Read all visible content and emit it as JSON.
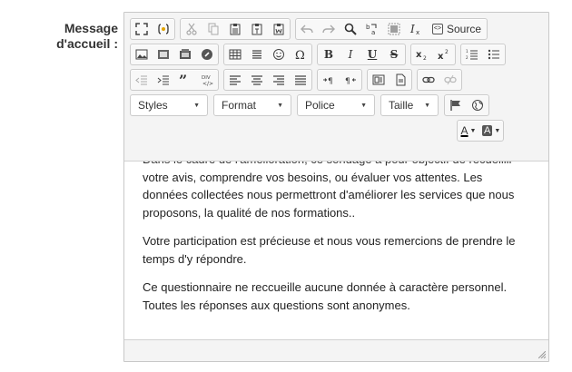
{
  "form": {
    "label": "Message d'accueil :"
  },
  "toolbar": {
    "source_label": "Source",
    "styles_label": "Styles",
    "format_label": "Format",
    "font_label": "Police",
    "size_label": "Taille",
    "bold_label": "B",
    "italic_label": "I",
    "underline_label": "U",
    "strike_label": "S",
    "text_color_label": "A",
    "bg_color_label": "A",
    "icons": [
      "maximize-icon",
      "show-blocks-icon",
      "cut-icon",
      "copy-icon",
      "paste-icon",
      "paste-text-icon",
      "paste-word-icon",
      "undo-icon",
      "redo-icon",
      "find-icon",
      "replace-icon",
      "select-all-icon",
      "remove-format-icon",
      "source-icon",
      "image-icon",
      "flash-icon",
      "media-icon",
      "iframe-icon",
      "table-icon",
      "horizontal-rule-icon",
      "smiley-icon",
      "special-char-icon",
      "subscript-icon",
      "superscript-icon",
      "numbered-list-icon",
      "bulleted-list-icon",
      "outdent-icon",
      "indent-icon",
      "blockquote-icon",
      "div-icon",
      "align-left-icon",
      "align-center-icon",
      "align-right-icon",
      "justify-icon",
      "ltr-icon",
      "rtl-icon",
      "template-icon",
      "page-icon",
      "link-icon",
      "unlink-icon",
      "anchor-icon",
      "globe-icon"
    ]
  },
  "content": {
    "cut_line": "Dans le cadre de l'amélioration, ce sondage a pour objectif de recueillir",
    "paragraphs": [
      "votre avis, comprendre vos besoins, ou évaluer vos attentes. Les données collectées nous permettront d'améliorer les services que nous proposons, la qualité de nos formations..",
      "Votre participation est précieuse et nous vous remercions de prendre le temps d'y répondre.",
      "Ce questionnaire ne reccueille aucune donnée à caractère personnel. Toutes les réponses aux questions sont anonymes."
    ]
  }
}
